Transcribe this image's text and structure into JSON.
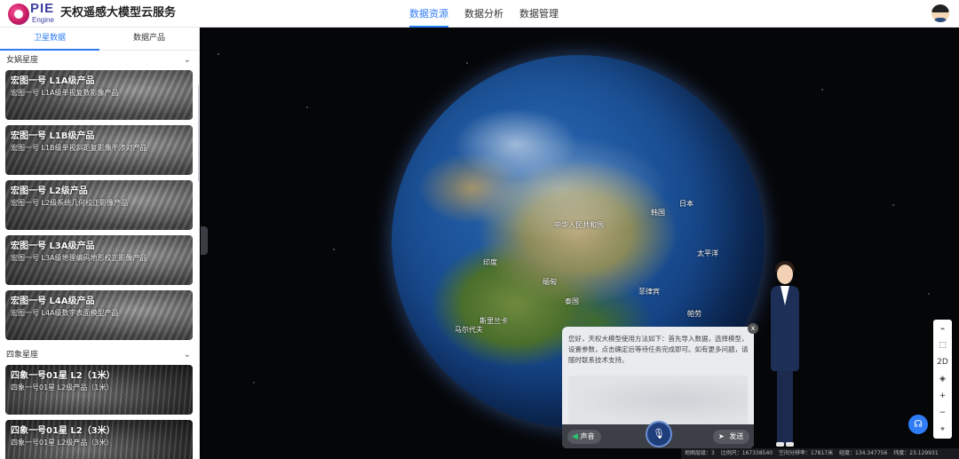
{
  "header": {
    "brand": "PIE",
    "brand_sub": "Engine",
    "app_title": "天权遥感大模型云服务",
    "nav": [
      {
        "label": "数据资源",
        "active": true
      },
      {
        "label": "数据分析",
        "active": false
      },
      {
        "label": "数据管理",
        "active": false
      }
    ]
  },
  "sidebar": {
    "tabs": [
      {
        "label": "卫星数据",
        "active": true
      },
      {
        "label": "数据产品",
        "active": false
      }
    ],
    "sections": [
      {
        "title": "女娲星座",
        "cards": [
          {
            "title": "宏图一号 L1A级产品",
            "desc": "宏图一号 L1A级单视复数影像产品"
          },
          {
            "title": "宏图一号 L1B级产品",
            "desc": "宏图一号 L1B级单视斜距复影像干涉对产品"
          },
          {
            "title": "宏图一号 L2级产品",
            "desc": "宏图一号 L2级系统几何校正影像产品"
          },
          {
            "title": "宏图一号 L3A级产品",
            "desc": "宏图一号 L3A级地理编码地形校正影像产品"
          },
          {
            "title": "宏图一号 L4A级产品",
            "desc": "宏图一号 L4A级数字表面模型产品"
          }
        ]
      },
      {
        "title": "四象星座",
        "cards": [
          {
            "title": "四象一号01星 L2（1米）",
            "desc": "四象一号01星 L2级产品（1米）"
          },
          {
            "title": "四象一号01星 L2（3米）",
            "desc": "四象一号01星 L2级产品（3米）"
          }
        ]
      }
    ]
  },
  "globe_labels": [
    {
      "text": "中华人民共和国"
    },
    {
      "text": "韩国"
    },
    {
      "text": "日本"
    },
    {
      "text": "印度"
    },
    {
      "text": "缅甸"
    },
    {
      "text": "泰国"
    },
    {
      "text": "菲律宾"
    },
    {
      "text": "太平洋"
    },
    {
      "text": "帕劳"
    },
    {
      "text": "马尔代夫"
    },
    {
      "text": "斯里兰卡"
    }
  ],
  "toolbar": {
    "items": [
      {
        "label": "⌁",
        "icon": "ruler-icon"
      },
      {
        "label": "⬚",
        "icon": "area-measure-icon"
      },
      {
        "label": "2D",
        "icon": "view-2d-toggle"
      },
      {
        "label": "◈",
        "icon": "layers-icon"
      },
      {
        "label": "+",
        "icon": "zoom-in-icon"
      },
      {
        "label": "−",
        "icon": "zoom-out-icon"
      },
      {
        "label": "⌖",
        "icon": "locate-icon"
      }
    ]
  },
  "chat": {
    "close": "x",
    "message": "您好，天权大模型使用方法如下：首先导入数据，选择模型，设置参数，点击确定后等待任务完成即可。如有更多问题，请随时联系技术支持。",
    "voice_label": "声音",
    "send_label": "发送"
  },
  "status_bar": {
    "items": [
      "地图层级：3",
      "比例尺：167338540",
      "空间分辨率：17817米",
      "经度：134.347756",
      "纬度：23.129931"
    ]
  },
  "colors": {
    "accent": "#2e7cf6",
    "brand": "#3b3f9e",
    "voice_icon": "#29c46a"
  }
}
